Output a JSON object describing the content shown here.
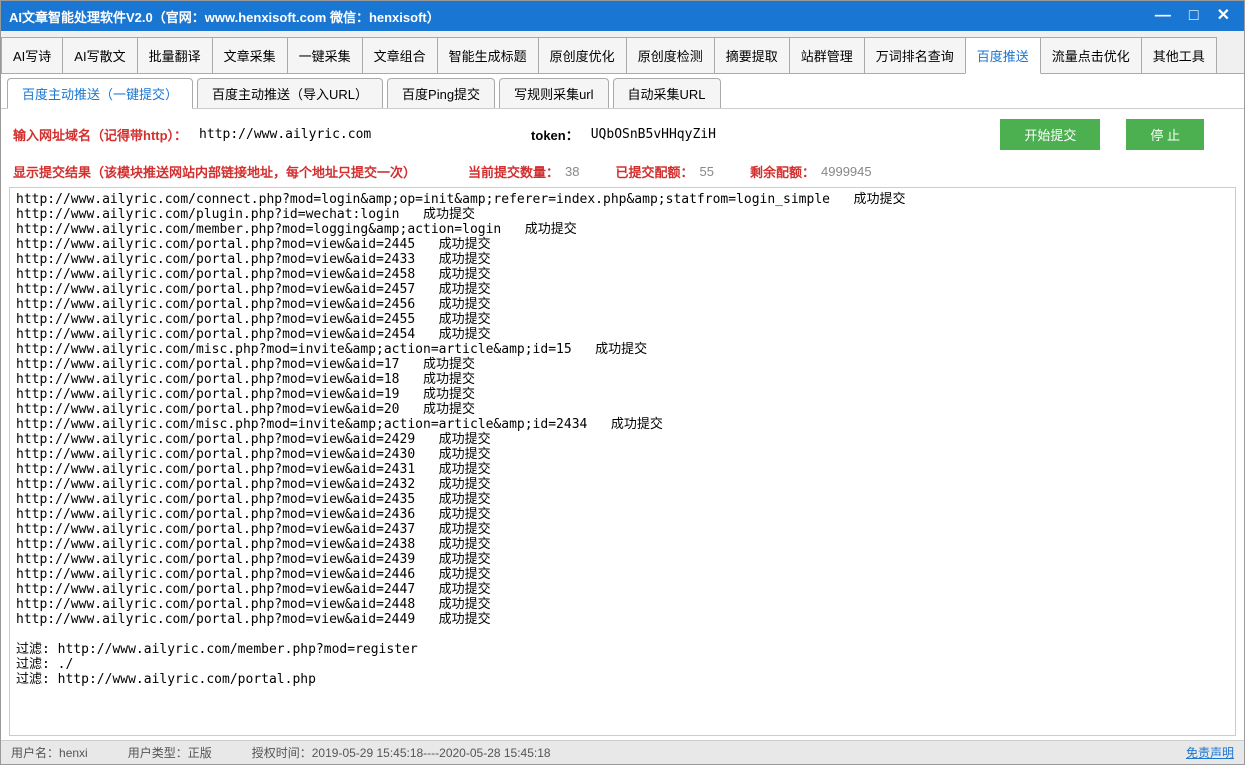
{
  "title": "AI文章智能处理软件V2.0（官网：www.henxisoft.com  微信：henxisoft）",
  "mainTabs": [
    "AI写诗",
    "AI写散文",
    "批量翻译",
    "文章采集",
    "一键采集",
    "文章组合",
    "智能生成标题",
    "原创度优化",
    "原创度检测",
    "摘要提取",
    "站群管理",
    "万词排名查询",
    "百度推送",
    "流量点击优化",
    "其他工具"
  ],
  "mainActive": 12,
  "subTabs": [
    "百度主动推送（一键提交）",
    "百度主动推送（导入URL）",
    "百度Ping提交",
    "写规则采集url",
    "自动采集URL"
  ],
  "subActive": 0,
  "form": {
    "domainLabel": "输入网址域名（记得带http）：",
    "domainValue": "http://www.ailyric.com",
    "tokenLabel": "token：",
    "tokenValue": "UQbOSnB5vHHqyZiH",
    "startBtn": "开始提交",
    "stopBtn": "停  止"
  },
  "stats": {
    "resultLabel": "显示提交结果（该模块推送网站内部链接地址，每个地址只提交一次）",
    "currentLabel": "当前提交数量：",
    "currentValue": "38",
    "submittedLabel": "已提交配额：",
    "submittedValue": "55",
    "remainLabel": "剩余配额：",
    "remainValue": "4999945"
  },
  "log": "http://www.ailyric.com/connect.php?mod=login&amp;op=init&amp;referer=index.php&amp;statfrom=login_simple   成功提交\nhttp://www.ailyric.com/plugin.php?id=wechat:login   成功提交\nhttp://www.ailyric.com/member.php?mod=logging&amp;action=login   成功提交\nhttp://www.ailyric.com/portal.php?mod=view&aid=2445   成功提交\nhttp://www.ailyric.com/portal.php?mod=view&aid=2433   成功提交\nhttp://www.ailyric.com/portal.php?mod=view&aid=2458   成功提交\nhttp://www.ailyric.com/portal.php?mod=view&aid=2457   成功提交\nhttp://www.ailyric.com/portal.php?mod=view&aid=2456   成功提交\nhttp://www.ailyric.com/portal.php?mod=view&aid=2455   成功提交\nhttp://www.ailyric.com/portal.php?mod=view&aid=2454   成功提交\nhttp://www.ailyric.com/misc.php?mod=invite&amp;action=article&amp;id=15   成功提交\nhttp://www.ailyric.com/portal.php?mod=view&aid=17   成功提交\nhttp://www.ailyric.com/portal.php?mod=view&aid=18   成功提交\nhttp://www.ailyric.com/portal.php?mod=view&aid=19   成功提交\nhttp://www.ailyric.com/portal.php?mod=view&aid=20   成功提交\nhttp://www.ailyric.com/misc.php?mod=invite&amp;action=article&amp;id=2434   成功提交\nhttp://www.ailyric.com/portal.php?mod=view&aid=2429   成功提交\nhttp://www.ailyric.com/portal.php?mod=view&aid=2430   成功提交\nhttp://www.ailyric.com/portal.php?mod=view&aid=2431   成功提交\nhttp://www.ailyric.com/portal.php?mod=view&aid=2432   成功提交\nhttp://www.ailyric.com/portal.php?mod=view&aid=2435   成功提交\nhttp://www.ailyric.com/portal.php?mod=view&aid=2436   成功提交\nhttp://www.ailyric.com/portal.php?mod=view&aid=2437   成功提交\nhttp://www.ailyric.com/portal.php?mod=view&aid=2438   成功提交\nhttp://www.ailyric.com/portal.php?mod=view&aid=2439   成功提交\nhttp://www.ailyric.com/portal.php?mod=view&aid=2446   成功提交\nhttp://www.ailyric.com/portal.php?mod=view&aid=2447   成功提交\nhttp://www.ailyric.com/portal.php?mod=view&aid=2448   成功提交\nhttp://www.ailyric.com/portal.php?mod=view&aid=2449   成功提交\n\n过滤: http://www.ailyric.com/member.php?mod=register\n过滤: ./\n过滤: http://www.ailyric.com/portal.php",
  "status": {
    "userLabel": "用户名：",
    "userValue": "henxi",
    "typeLabel": "用户类型：",
    "typeValue": "正版",
    "authLabel": "授权时间：",
    "authValue": "2019-05-29 15:45:18----2020-05-28 15:45:18",
    "disclaimer": "免责声明"
  }
}
